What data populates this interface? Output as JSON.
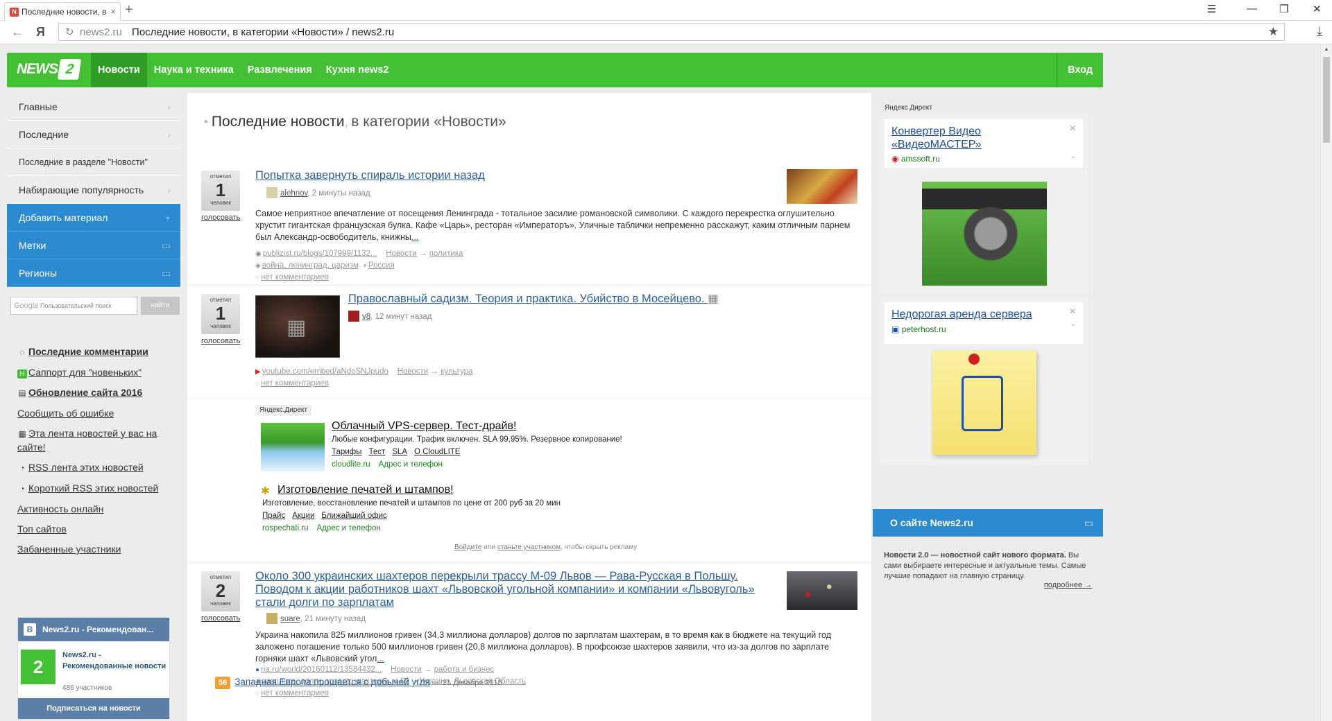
{
  "browser": {
    "tab_title": "Последние новости, в",
    "url_host": "news2.ru",
    "url_title": "Последние новости, в категории «Новости» / news2.ru"
  },
  "site": {
    "logo_text": "NEWS",
    "logo_badge": "2",
    "nav": [
      "Новости",
      "Наука и техника",
      "Развлечения",
      "Кухня news2"
    ],
    "login": "Вход"
  },
  "sidebar": {
    "menu": [
      "Главные",
      "Последние",
      "Последние в разделе \"Новости\"",
      "Набирающие популярность"
    ],
    "actions": [
      "Добавить материал",
      "Метки",
      "Регионы"
    ],
    "search_placeholder_brand": "Google",
    "search_placeholder": "Пользовательский поиск",
    "search_button": "найти",
    "links": [
      "Последние комментарии",
      "Саппорт для \"новеньких\"",
      "Обновление сайта 2016",
      "Сообщить об ошибке",
      "Эта лента новостей у вас на сайте!",
      "RSS лента этих новостей",
      "Короткий RSS этих новостей",
      "Активность онлайн",
      "Топ сайтов",
      "Забаненные участники"
    ],
    "vk": {
      "header": "News2.ru - Рекомендован...",
      "name": "News2.ru - Рекомендованные новости",
      "members": "486 участников",
      "subscribe": "Подписаться на новости",
      "logo": "B",
      "avatar": "2"
    }
  },
  "main": {
    "title": "Последние новости",
    "comma": ",",
    "category": "в категории «Новости»",
    "vote_label_top": "отметил",
    "vote_label_bottom": "человек",
    "vote_link": "голосовать",
    "posts": [
      {
        "votes": "1",
        "title": "Попытка завернуть спираль истории назад",
        "user": "alehnov",
        "time": ", 2 минуты назад",
        "text": "Самое неприятное впечатление от посещения Ленинграда - тотальное засилие романовской символики. С каждого перекрестка оглушительно хрустит гигантская французская булка. Кафе «Царь», ресторан «Императоръ». Уличные таблички непременно расскажут, каким отличным парнем был Александр-освободитель, книжны",
        "more": "...",
        "source": "publizist.ru/blogs/107999/1132...",
        "cat1": "Новости",
        "arrow": "→",
        "cat2": "политика",
        "tags": "война, ленинград, царизм",
        "region": "Россия",
        "comments": "нет комментариев"
      },
      {
        "votes": "1",
        "title": "Православный садизм. Теория и практика. Убийство в Мосейцево.",
        "user": "v8",
        "time": ", 12 минут назад",
        "source": "youtube.com/embed/aNdoSNJpudo",
        "cat1": "Новости",
        "arrow": "→",
        "cat2": "культура",
        "comments": "нет комментариев"
      },
      {
        "votes": "2",
        "title": "Около 300 украинских шахтеров перекрыли трассу М-09 Львов — Рава-Русская в Польшу. Поводом к акции работников шахт «Львовской угольной компании» и компании «Львовуголь» стали долги по зарплатам",
        "user": "suare",
        "time": ", 21 минуту назад",
        "text": "Украина накопила 825 миллионов гривен (34,3 миллиона долларов) долгов по зарплатам шахтерам, в то время как в бюджете на текущий год заложено погашение только 500 миллионов гривен (20,8 миллиона долларов). В профсоюзе шахтеров заявили, что из-за долгов по зарплате горняки шахт «Львовский угол",
        "more": "...",
        "source": "ria.ru/world/20160112/13584432...",
        "cat1": "Новости",
        "arrow": "→",
        "cat2": "работа и бизнес",
        "tags": "зарплата, долги, трасса, шахтеры, м-09",
        "region": "Украина, Львовская Область",
        "comments": "нет комментариев"
      }
    ],
    "direct": {
      "label": "Яндекс.Директ",
      "ads": [
        {
          "title": "Облачный VPS-сервер. Тест-драйв!",
          "desc": "Любые конфигурации. Трафик включен. SLA 99,95%. Резервное копирование!",
          "links": [
            "Тарифы",
            "Тест",
            "SLA",
            "О CloudLITE"
          ],
          "domain": "cloudlite.ru",
          "contact": "Адрес и телефон"
        },
        {
          "title": "Изготовление печатей и штампов!",
          "desc": "Изготовление, восстановление печатей и штампов по цене от 200 руб за 20 мин",
          "links": [
            "Прайс",
            "Акции",
            "Ближайший офис"
          ],
          "domain": "rospechati.ru",
          "contact": "Адрес и телефон"
        }
      ],
      "foot_login": "Войдите",
      "foot_or": " или ",
      "foot_join": "станьте участником",
      "foot_rest": ", чтобы скрыть рекламу"
    },
    "bottom_item": {
      "rank": "56",
      "title": "Западная Европа прощается с добычей угля",
      "date": "— 21 Декабря 2015"
    }
  },
  "right": {
    "direct_label": "Яндекс Директ",
    "ads": [
      {
        "title": "Конвертер Видео «ВидеоМАСТЕР»",
        "domain": "amssoft.ru"
      },
      {
        "title": "Недорогая аренда сервера",
        "domain": "peterhost.ru"
      }
    ],
    "about_title": "О сайте News2.ru",
    "about_bold": "Новости 2.0 — новостной сайт нового формата.",
    "about_text": " Вы сами выбираете интересные и актуальные темы. Самые лучшие попадают на главную страницу.",
    "about_more": "подробнее →"
  },
  "colors": {
    "brand_green": "#43c033",
    "accent_blue": "#2c8bd0",
    "link_blue": "#2c5f9f"
  }
}
